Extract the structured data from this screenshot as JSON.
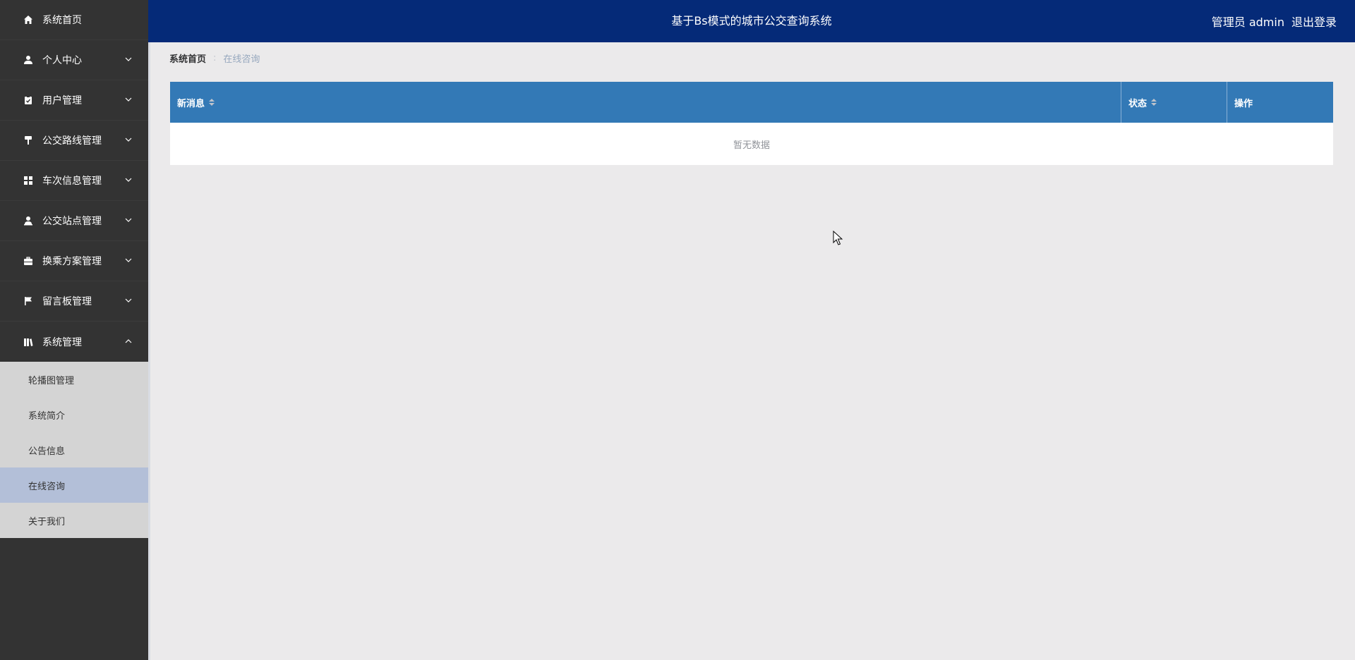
{
  "header": {
    "title": "基于Bs模式的城市公交查询系统",
    "user_label": "管理员 admin",
    "logout_label": "退出登录",
    "bg_color": "#052a78"
  },
  "sidebar": {
    "items": [
      {
        "label": "系统首页",
        "icon": "home-icon"
      },
      {
        "label": "个人中心",
        "icon": "user-icon",
        "expandable": true
      },
      {
        "label": "用户管理",
        "icon": "clipboard-check-icon",
        "expandable": true
      },
      {
        "label": "公交路线管理",
        "icon": "paint-roller-icon",
        "expandable": true
      },
      {
        "label": "车次信息管理",
        "icon": "grid-icon",
        "expandable": true
      },
      {
        "label": "公交站点管理",
        "icon": "user-stamp-icon",
        "expandable": true
      },
      {
        "label": "换乘方案管理",
        "icon": "briefcase-icon",
        "expandable": true
      },
      {
        "label": "留言板管理",
        "icon": "flag-icon",
        "expandable": true
      },
      {
        "label": "系统管理",
        "icon": "book-icon",
        "expandable": true,
        "expanded": true
      }
    ],
    "subitems": [
      {
        "label": "轮播图管理"
      },
      {
        "label": "系统简介"
      },
      {
        "label": "公告信息"
      },
      {
        "label": "在线咨询",
        "active": true
      },
      {
        "label": "关于我们"
      }
    ]
  },
  "breadcrumb": {
    "home": "系统首页",
    "current": "在线咨询"
  },
  "table": {
    "columns": [
      "新消息",
      "状态",
      "操作"
    ],
    "empty_text": "暂无数据",
    "header_color": "#3379b6"
  }
}
